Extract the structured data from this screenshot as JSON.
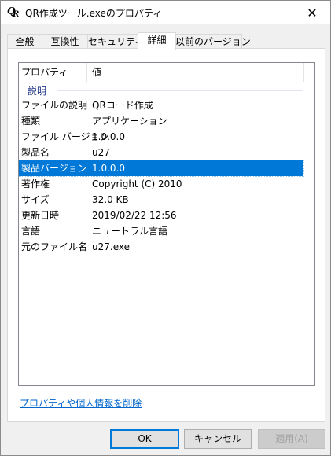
{
  "window": {
    "title": "QR作成ツール.exeのプロパティ",
    "close_glyph": "✕",
    "app_icon_q": "Q",
    "app_icon_r": "R"
  },
  "tabs": [
    {
      "label": "全般",
      "active": false
    },
    {
      "label": "互換性",
      "active": false
    },
    {
      "label": "セキュリティ",
      "active": false
    },
    {
      "label": "詳細",
      "active": true
    },
    {
      "label": "以前のバージョン",
      "active": false
    }
  ],
  "details": {
    "header": {
      "property": "プロパティ",
      "value": "値"
    },
    "group": "説明",
    "rows": [
      {
        "key": "ファイルの説明",
        "value": "QRコード作成",
        "selected": false
      },
      {
        "key": "種類",
        "value": "アプリケーション",
        "selected": false
      },
      {
        "key": "ファイル バージョン",
        "value": "1.0.0.0",
        "selected": false
      },
      {
        "key": "製品名",
        "value": "u27",
        "selected": false
      },
      {
        "key": "製品バージョン",
        "value": "1.0.0.0",
        "selected": true
      },
      {
        "key": "著作権",
        "value": "Copyright (C)  2010",
        "selected": false
      },
      {
        "key": "サイズ",
        "value": "32.0 KB",
        "selected": false
      },
      {
        "key": "更新日時",
        "value": "2019/02/22 12:56",
        "selected": false
      },
      {
        "key": "言語",
        "value": "ニュートラル言語",
        "selected": false
      },
      {
        "key": "元のファイル名",
        "value": "u27.exe",
        "selected": false
      }
    ]
  },
  "remove_link": "プロパティや個人情報を削除",
  "buttons": {
    "ok": "OK",
    "cancel": "キャンセル",
    "apply": "適用(A)"
  },
  "colors": {
    "selection": "#0078d7",
    "link": "#0066cc",
    "group": "#1e3287"
  }
}
